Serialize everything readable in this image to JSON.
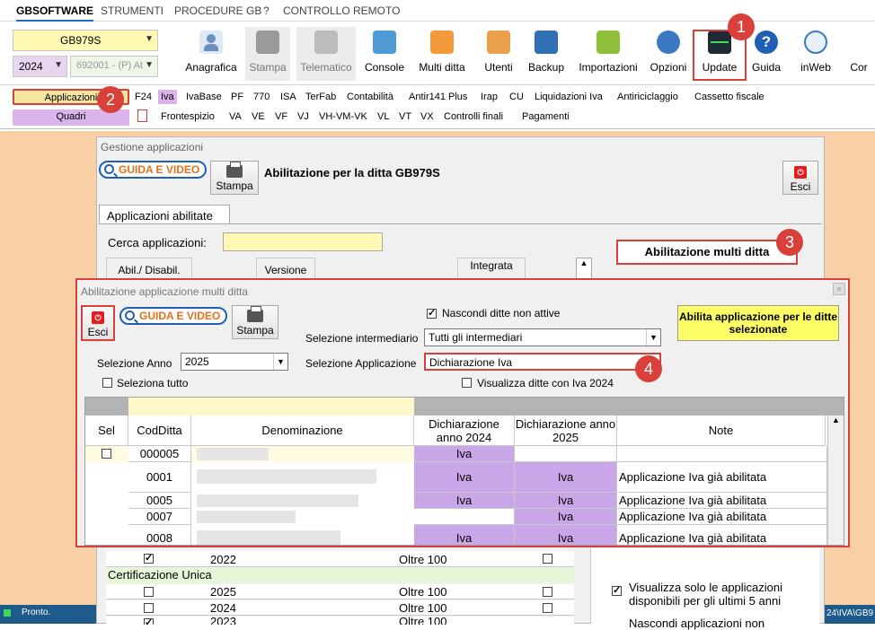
{
  "menu": [
    "GBSOFTWARE",
    "STRUMENTI",
    "PROCEDURE GB",
    "?",
    "CONTROLLO REMOTO"
  ],
  "ditta_combo": "GB979S",
  "anno_combo": "2024",
  "ditta_desc_combo": "692001 - (P) At",
  "toolbar": [
    "Anagrafica",
    "Stampa",
    "Telematico",
    "Console",
    "Multi ditta",
    "Utenti",
    "Backup",
    "Importazioni",
    "Opzioni",
    "Update",
    "Guida",
    "inWeb",
    "Cor"
  ],
  "left_tabs": {
    "applicazioni": "Applicazioni",
    "quadri": "Quadri"
  },
  "app_tabs_row1": [
    "F24",
    "Iva",
    "IvaBase",
    "PF",
    "770",
    "ISA",
    "TerFab",
    "Contabilità",
    "Antir141 Plus",
    "Irap",
    "CU",
    "Liquidazioni Iva",
    "Antiriciclaggio",
    "Cassetto fiscale"
  ],
  "app_tabs_row2": [
    "Frontespizio",
    "VA",
    "VE",
    "VF",
    "VJ",
    "VH-VM-VK",
    "VL",
    "VT",
    "VX",
    "Controlli finali",
    "Pagamenti"
  ],
  "badges": [
    "1",
    "2",
    "3",
    "4"
  ],
  "gestione": {
    "title": "Gestione applicazioni",
    "guida": "GUIDA E VIDEO",
    "stampa": "Stampa",
    "heading": "Abilitazione per la ditta GB979S",
    "esci": "Esci",
    "tab": "Applicazioni abilitate",
    "cerca_label": "Cerca applicazioni:",
    "multi_btn": "Abilitazione multi ditta",
    "col_abil": "Abil./ Disabil.",
    "col_versione": "Versione",
    "col_integrata": "Integrata",
    "lower_rows": [
      {
        "year": "2022",
        "val": "Oltre 100"
      },
      {
        "section": "Certificazione Unica"
      },
      {
        "year": "2025",
        "val": "Oltre 100"
      },
      {
        "year": "2024",
        "val": "Oltre 100"
      },
      {
        "year": "2023",
        "val": "Oltre 100"
      }
    ],
    "visualizza_5": "Visualizza solo le applicazioni disponibili per gli ultimi 5 anni",
    "nascondi_app": "Nascondi applicazioni non"
  },
  "multi": {
    "title": "Abilitazione applicazione multi ditta",
    "esci": "Esci",
    "guida": "GUIDA E VIDEO",
    "stampa": "Stampa",
    "nascondi": "Nascondi ditte non attive",
    "sel_intermediario_label": "Selezione intermediario",
    "sel_intermediario": "Tutti gli intermediari",
    "abilita_btn": "Abilita applicazione per le ditte selezionate",
    "sel_anno_label": "Selezione Anno",
    "sel_anno": "2025",
    "sel_app_label": "Selezione Applicazione",
    "sel_app": "Dichiarazione Iva",
    "seleziona_tutto": "Seleziona tutto",
    "visualizza_iva": "Visualizza ditte con Iva 2024",
    "headers": [
      "Sel",
      "CodDitta",
      "Denominazione",
      "Dichiarazione anno 2024",
      "Dichiarazione anno 2025",
      "Note"
    ],
    "rows": [
      {
        "cod": "000005",
        "d24": "Iva",
        "d25": "",
        "note": ""
      },
      {
        "cod": "0001",
        "d24": "Iva",
        "d25": "Iva",
        "note": "Applicazione Iva già abilitata"
      },
      {
        "cod": "0005",
        "d24": "Iva",
        "d25": "Iva",
        "note": "Applicazione Iva già abilitata"
      },
      {
        "cod": "0007",
        "d24": "",
        "d25": "Iva",
        "note": "Applicazione Iva già abilitata"
      },
      {
        "cod": "0008",
        "d24": "Iva",
        "d25": "Iva",
        "note": "Applicazione Iva già abilitata"
      }
    ]
  },
  "status": {
    "left": "Pronto.",
    "right": "24\\IVA\\GB9"
  }
}
